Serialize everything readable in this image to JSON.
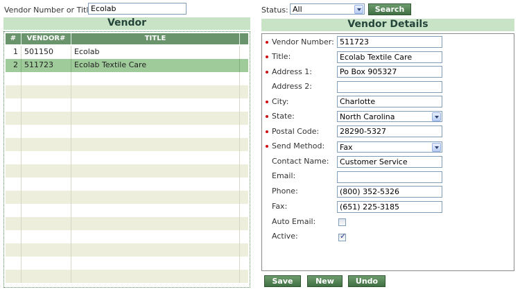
{
  "search": {
    "label": "Vendor Number or Title:",
    "value": "Ecolab",
    "status_label": "Status:",
    "status_value": "All",
    "button_label": "Search"
  },
  "vendor_section": {
    "title": "Vendor",
    "columns": [
      "#",
      "VENDOR#",
      "TITLE"
    ],
    "rows": [
      {
        "num": "1",
        "vendor": "501150",
        "title": "Ecolab"
      },
      {
        "num": "2",
        "vendor": "511723",
        "title": "Ecolab Textile Care"
      }
    ]
  },
  "details": {
    "title": "Vendor Details",
    "fields": {
      "vendor_number": {
        "label": "Vendor Number:",
        "value": "511723"
      },
      "title": {
        "label": "Title:",
        "value": "Ecolab Textile Care"
      },
      "address1": {
        "label": "Address 1:",
        "value": "Po Box 905327"
      },
      "address2": {
        "label": "Address 2:",
        "value": ""
      },
      "city": {
        "label": "City:",
        "value": "Charlotte"
      },
      "state": {
        "label": "State:",
        "value": "North Carolina"
      },
      "postal_code": {
        "label": "Postal Code:",
        "value": "28290-5327"
      },
      "send_method": {
        "label": "Send Method:",
        "value": "Fax"
      },
      "contact_name": {
        "label": "Contact Name:",
        "value": "Customer Service"
      },
      "email": {
        "label": "Email:",
        "value": ""
      },
      "phone": {
        "label": "Phone:",
        "value": "(800) 352-5326"
      },
      "fax": {
        "label": "Fax:",
        "value": "(651) 225-3185"
      },
      "auto_email": {
        "label": "Auto Email:",
        "checked": false
      },
      "active": {
        "label": "Active:",
        "checked": true
      }
    }
  },
  "actions": {
    "save": "Save",
    "new": "New",
    "undo": "Undo"
  },
  "colors": {
    "header_green": "#c9e3c6",
    "grid_header": "#6a946b",
    "selected_row": "#9ecb99",
    "alt_row": "#eeeedd",
    "button_green": "#4f7f52",
    "required_marker": "#d01010"
  },
  "icons": {
    "dropdown": "chevron-down-icon",
    "checkbox_checked": "check-icon"
  }
}
